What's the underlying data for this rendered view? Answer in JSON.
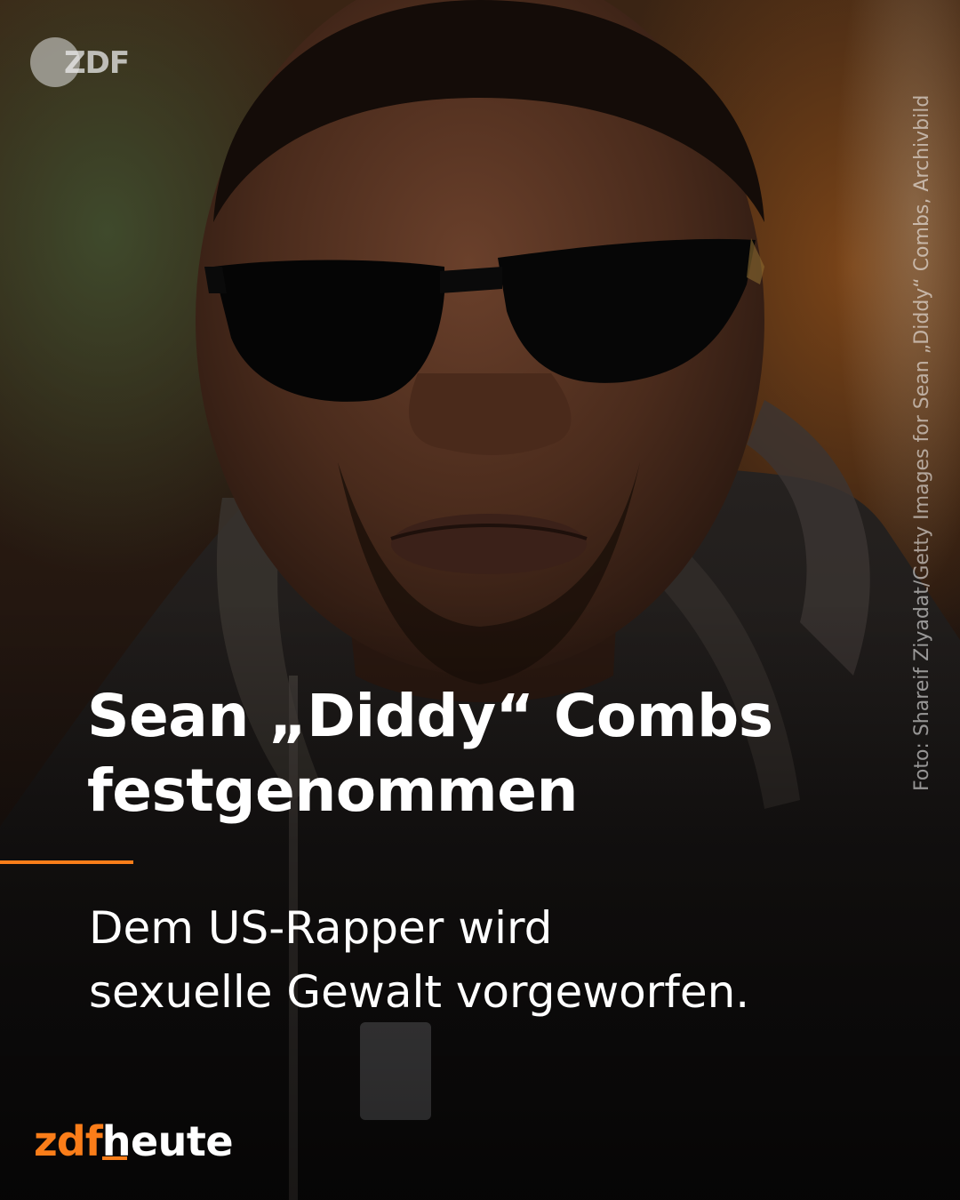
{
  "photo": {
    "subject_icon": "portrait-photo-icon"
  },
  "watermark": {
    "label": "ZDF"
  },
  "credit": "Foto: Shareif Ziyadat/Getty Images for Sean „Diddy“ Combs, Archivbild",
  "headline": "Sean „Diddy“ Combs\nfestgenommen",
  "subline": "Dem US-Rapper wird\nsexuelle Gewalt vorgeworfen.",
  "brand": {
    "part1": "zdf",
    "part2": "heute"
  },
  "colors": {
    "accent": "#fa7d19",
    "text": "#ffffff"
  }
}
